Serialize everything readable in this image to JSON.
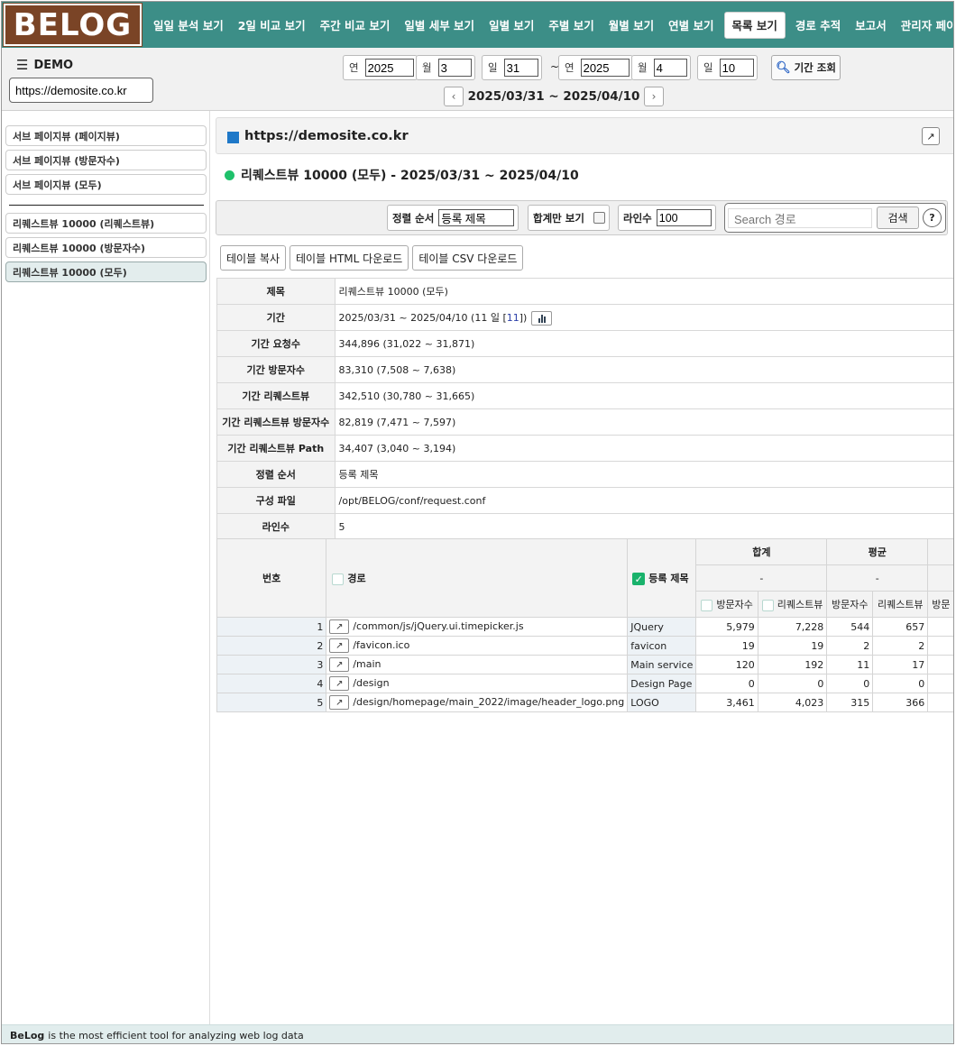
{
  "app": {
    "logo": "BELOG"
  },
  "nav": {
    "items": [
      {
        "label": "일일 분석 보기",
        "active": false
      },
      {
        "label": "2일 비교 보기",
        "active": false
      },
      {
        "label": "주간 비교 보기",
        "active": false
      },
      {
        "label": "일별 세부 보기",
        "active": false
      },
      {
        "label": "일별 보기",
        "active": false
      },
      {
        "label": "주별 보기",
        "active": false
      },
      {
        "label": "월별 보기",
        "active": false
      },
      {
        "label": "연별 보기",
        "active": false
      },
      {
        "label": "목록 보기",
        "active": true
      },
      {
        "label": "경로 추적",
        "active": false
      },
      {
        "label": "보고서",
        "active": false
      },
      {
        "label": "관리자 페이지",
        "active": false
      }
    ]
  },
  "header": {
    "demo_label": "DEMO",
    "site_value": "https://demosite.co.kr",
    "start": {
      "year_label": "연",
      "year": "2025",
      "month_label": "월",
      "month": "3",
      "day_label": "일",
      "day": "31"
    },
    "tilde": "~",
    "end": {
      "year_label": "연",
      "year": "2025",
      "month_label": "월",
      "month": "4",
      "day_label": "일",
      "day": "10"
    },
    "search_label": "기간 조회",
    "period_text": "2025/03/31 ~ 2025/04/10"
  },
  "sidebar": {
    "group1": [
      {
        "label": "서브 페이지뷰 (페이지뷰)"
      },
      {
        "label": "서브 페이지뷰 (방문자수)"
      },
      {
        "label": "서브 페이지뷰 (모두)"
      }
    ],
    "group2": [
      {
        "label": "리퀘스트뷰 10000 (리퀘스트뷰)"
      },
      {
        "label": "리퀘스트뷰 10000 (방문자수)"
      },
      {
        "label": "리퀘스트뷰 10000 (모두)",
        "active": true
      }
    ]
  },
  "main": {
    "site_title": "https://demosite.co.kr",
    "report_title": "리퀘스트뷰 10000 (모두) - 2025/03/31 ~ 2025/04/10",
    "toolbar": {
      "sort_label": "정렬 순서",
      "sort_value": "등록 제목",
      "totals_only_label": "합계만 보기",
      "lines_label": "라인수",
      "lines_value": "100",
      "search_placeholder": "Search 경로",
      "search_button": "검색",
      "help": "?"
    },
    "downloads": [
      "테이블 복사",
      "테이블 HTML 다운로드",
      "테이블 CSV 다운로드"
    ],
    "info": [
      {
        "key": "제목",
        "value": "리퀘스트뷰 10000 (모두)"
      },
      {
        "key": "기간",
        "value": "2025/03/31 ~ 2025/04/10 (11 일 [",
        "link": "11",
        "tail": "])"
      },
      {
        "key": "기간 요청수",
        "value": "344,896 (31,022 ~ 31,871)"
      },
      {
        "key": "기간 방문자수",
        "value": "83,310 (7,508 ~ 7,638)"
      },
      {
        "key": "기간 리퀘스트뷰",
        "value": "342,510 (30,780 ~ 31,665)"
      },
      {
        "key": "기간 리퀘스트뷰 방문자수",
        "value": "82,819 (7,471 ~ 7,597)"
      },
      {
        "key": "기간 리퀘스트뷰 Path",
        "value": "34,407 (3,040 ~ 3,194)"
      },
      {
        "key": "정렬 순서",
        "value": "등록 제목"
      },
      {
        "key": "구성 파일",
        "value": "/opt/BELOG/conf/request.conf"
      },
      {
        "key": "라인수",
        "value": "5"
      }
    ],
    "table": {
      "headers": {
        "no": "번호",
        "path": "경로",
        "title": "등록 제목",
        "sum": "합계",
        "avg": "평균",
        "sum_sub": "-",
        "avg_sub": "-",
        "visitors": "방문자수",
        "requestviews": "리퀘스트뷰",
        "visitors_cut": "방문"
      },
      "rows": [
        {
          "no": "1",
          "path": "/common/js/jQuery.ui.timepicker.js",
          "title": "JQuery",
          "sum_v": "5,979",
          "sum_r": "7,228",
          "avg_v": "544",
          "avg_r": "657"
        },
        {
          "no": "2",
          "path": "/favicon.ico",
          "title": "favicon",
          "sum_v": "19",
          "sum_r": "19",
          "avg_v": "2",
          "avg_r": "2"
        },
        {
          "no": "3",
          "path": "/main",
          "title": "Main service",
          "sum_v": "120",
          "sum_r": "192",
          "avg_v": "11",
          "avg_r": "17"
        },
        {
          "no": "4",
          "path": "/design",
          "title": "Design Page",
          "sum_v": "0",
          "sum_r": "0",
          "avg_v": "0",
          "avg_r": "0"
        },
        {
          "no": "5",
          "path": "/design/homepage/main_2022/image/header_logo.png",
          "title": "LOGO",
          "sum_v": "3,461",
          "sum_r": "4,023",
          "avg_v": "315",
          "avg_r": "366"
        }
      ]
    }
  },
  "footer": {
    "brand": "BeLog",
    "text": "is the most efficient tool for analyzing web log data"
  }
}
